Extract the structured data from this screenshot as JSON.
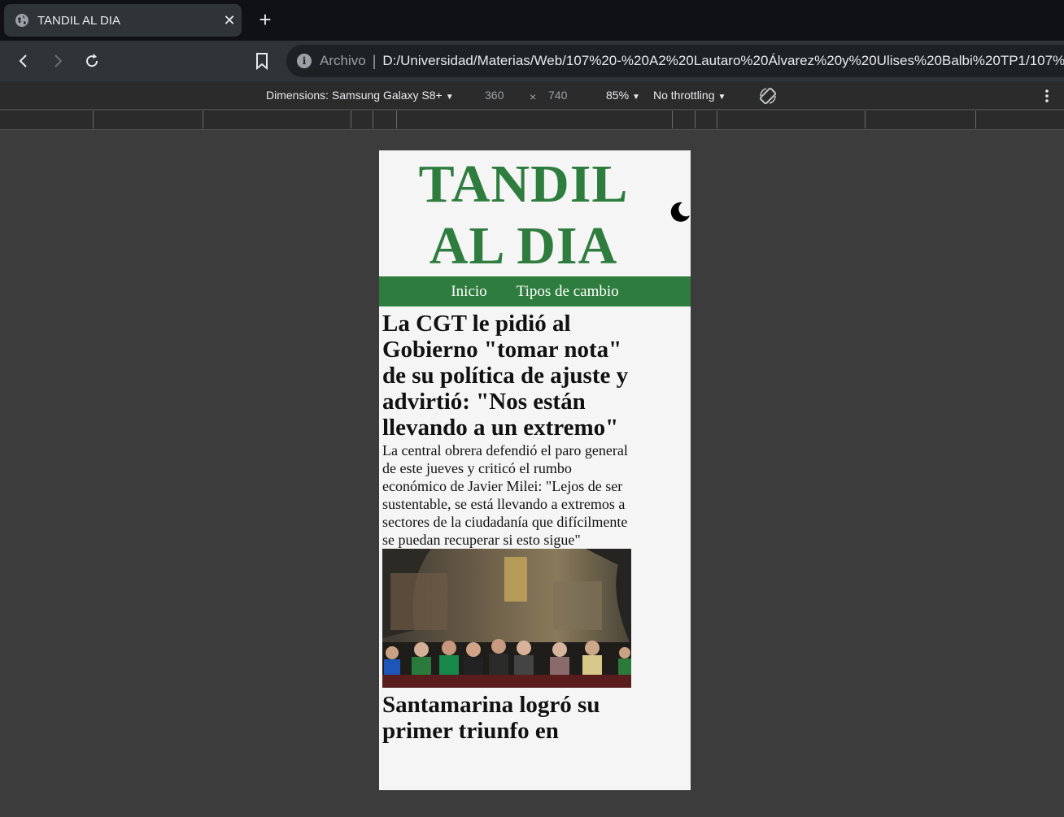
{
  "browser": {
    "tab_title": "TANDIL AL DIA",
    "tab_close": "✕",
    "new_tab": "+",
    "scheme_label": "Archivo",
    "url_separator": "|",
    "url": "D:/Universidad/Materias/Web/107%20-%20A2%20Lautaro%20Álvarez%20y%20Ulises%20Balbi%20TP1/107%",
    "icons": [
      "globe-icon",
      "back-icon",
      "forward-icon",
      "reload-icon",
      "bookmark-icon",
      "info-icon"
    ]
  },
  "devtools": {
    "device_label": "Dimensions: Samsung Galaxy S8+",
    "width": "360",
    "times": "×",
    "height": "740",
    "zoom": "85%",
    "throttling": "No throttling",
    "icons": [
      "rotate-icon",
      "more-options-icon"
    ]
  },
  "site": {
    "logo": "TANDIL AL DIA",
    "nav": [
      "Inicio",
      "Tipos de cambio"
    ],
    "colors": {
      "brand": "#2e7d3e",
      "background": "#f5f5f5"
    },
    "articles": [
      {
        "title": "La CGT le pidió al Gobierno \"tomar nota\" de su política de ajuste y advirtió: \"Nos están llevando a un extremo\"",
        "summary": "La central obrera defendió el paro general de este jueves y criticó el rumbo económico de Javier Milei: \"Lejos de ser sustentable, se está llevando a extremos a sectores de la ciudadanía que difícilmente se puedan recuperar si esto sigue\""
      },
      {
        "title": "Santamarina logró su primer triunfo en"
      }
    ]
  }
}
